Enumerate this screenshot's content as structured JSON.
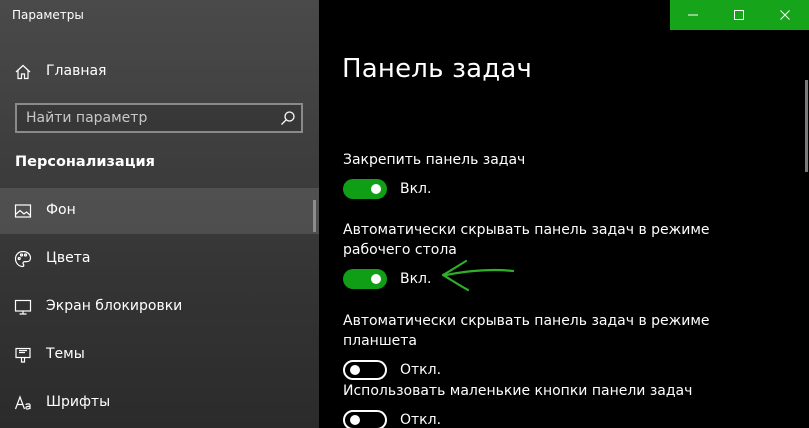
{
  "window": {
    "title": "Параметры"
  },
  "sidebar": {
    "home_label": "Главная",
    "search_placeholder": "Найти параметр",
    "section_title": "Персонализация",
    "items": [
      {
        "label": "Фон",
        "icon": "picture-icon",
        "selected": true
      },
      {
        "label": "Цвета",
        "icon": "palette-icon",
        "selected": false
      },
      {
        "label": "Экран блокировки",
        "icon": "lock-screen-icon",
        "selected": false
      },
      {
        "label": "Темы",
        "icon": "themes-icon",
        "selected": false
      },
      {
        "label": "Шрифты",
        "icon": "fonts-icon",
        "selected": false
      }
    ]
  },
  "content": {
    "title": "Панель задач",
    "settings": [
      {
        "label": "Закрепить панель задач",
        "state": "on",
        "state_label": "Вкл."
      },
      {
        "label": "Автоматически скрывать панель задач в режиме рабочего стола",
        "state": "on",
        "state_label": "Вкл."
      },
      {
        "label": "Автоматически скрывать панель задач в режиме планшета",
        "state": "off",
        "state_label": "Откл."
      },
      {
        "label": "Использовать маленькие кнопки панели задач",
        "state": "off",
        "state_label": "Откл."
      }
    ]
  },
  "colors": {
    "accent": "#16a51a",
    "toggle_on": "#109e16",
    "annotation": "#2fae2a"
  }
}
